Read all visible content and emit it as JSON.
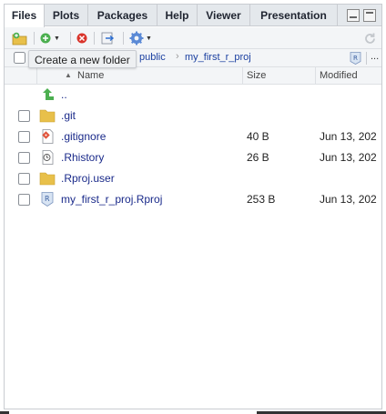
{
  "tabs": [
    {
      "label": "Files",
      "active": true
    },
    {
      "label": "Plots",
      "active": false
    },
    {
      "label": "Packages",
      "active": false
    },
    {
      "label": "Help",
      "active": false
    },
    {
      "label": "Viewer",
      "active": false
    },
    {
      "label": "Presentation",
      "active": false
    }
  ],
  "toolbar": {
    "icons": [
      "new-folder-icon",
      "new-blank-file-icon",
      "delete-icon",
      "rename-icon",
      "gear-icon",
      "refresh-icon"
    ]
  },
  "tooltip": {
    "text": "Create a new folder"
  },
  "path": {
    "segments": [
      "public",
      "my_first_r_proj"
    ],
    "more": "..."
  },
  "columns": {
    "name": "Name",
    "size": "Size",
    "modified": "Modified"
  },
  "parent_dir": {
    "label": ".."
  },
  "files": [
    {
      "name": ".git",
      "size": "",
      "modified": "",
      "icon": "folder-icon"
    },
    {
      "name": ".gitignore",
      "size": "40 B",
      "modified": "Jun 13, 202",
      "icon": "gitignore-file-icon"
    },
    {
      "name": ".Rhistory",
      "size": "26 B",
      "modified": "Jun 13, 202",
      "icon": "history-file-icon"
    },
    {
      "name": ".Rproj.user",
      "size": "",
      "modified": "",
      "icon": "folder-icon"
    },
    {
      "name": "my_first_r_proj.Rproj",
      "size": "253 B",
      "modified": "Jun 13, 202",
      "icon": "rproj-file-icon"
    }
  ],
  "colors": {
    "link": "#1a2a8a",
    "path_link": "#1a3fa0",
    "folder": "#e8c04a",
    "up_arrow": "#4caf50",
    "delete": "#d9342b"
  }
}
